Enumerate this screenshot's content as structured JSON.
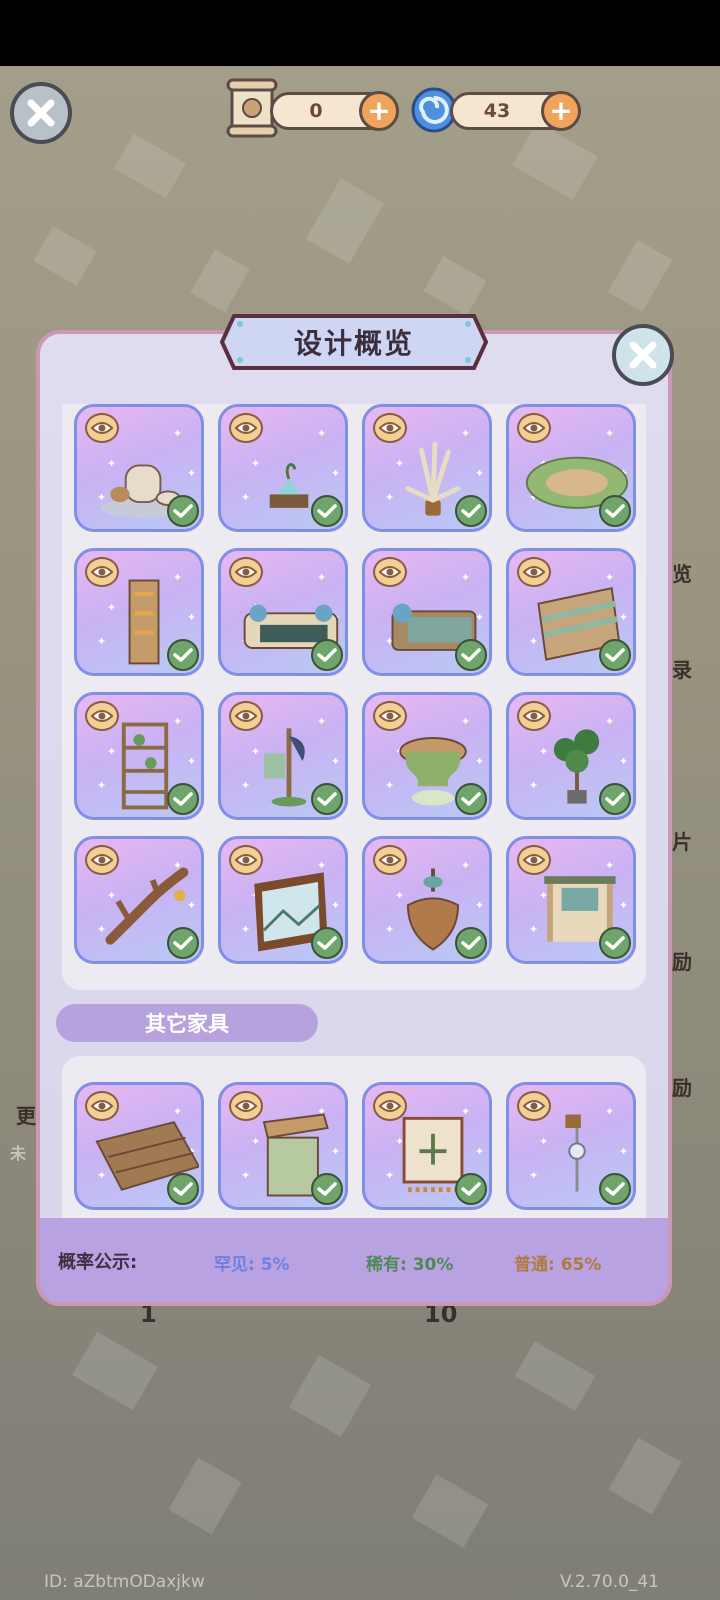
{
  "currency": {
    "scrolls": "0",
    "swirls": "43"
  },
  "modal": {
    "title": "设计概览",
    "section_other": "其它家具"
  },
  "cards_main": [
    {
      "name": "tea-set",
      "icon": "teapot-icon"
    },
    {
      "name": "potted-succulent",
      "icon": "succulent-icon"
    },
    {
      "name": "pampas-vase",
      "icon": "pampas-grass-icon"
    },
    {
      "name": "moss-rug",
      "icon": "moss-rug-icon"
    },
    {
      "name": "flower-trellis",
      "icon": "trellis-icon"
    },
    {
      "name": "sofa",
      "icon": "sofa-icon"
    },
    {
      "name": "bed",
      "icon": "bed-icon"
    },
    {
      "name": "dresser",
      "icon": "dresser-icon"
    },
    {
      "name": "bookshelf",
      "icon": "shelf-icon"
    },
    {
      "name": "coat-rack",
      "icon": "coat-rack-icon"
    },
    {
      "name": "moss-stool",
      "icon": "stool-icon"
    },
    {
      "name": "potted-tree",
      "icon": "tree-icon"
    },
    {
      "name": "antler-bells",
      "icon": "antler-icon"
    },
    {
      "name": "landscape-painting",
      "icon": "painting-icon"
    },
    {
      "name": "pinecone-lamp",
      "icon": "pinecone-icon"
    },
    {
      "name": "window-curtain",
      "icon": "curtain-icon"
    }
  ],
  "cards_other": [
    {
      "name": "wood-floor",
      "icon": "floor-icon"
    },
    {
      "name": "side-table",
      "icon": "table-icon"
    },
    {
      "name": "tapestry",
      "icon": "tapestry-icon"
    },
    {
      "name": "wind-chime",
      "icon": "chime-icon"
    }
  ],
  "probability": {
    "label": "概率公示:",
    "rare": "罕见: 5%",
    "uncommon": "稀有: 30%",
    "common": "普通: 65%",
    "colors": {
      "rare": "#6f7fe0",
      "uncommon": "#4f8a55",
      "common": "#b07a3e"
    }
  },
  "side": {
    "l1": "览",
    "l2": "录",
    "l3": "片",
    "l4": "励",
    "l5": "励",
    "left1": "更",
    "left2": "未"
  },
  "bottom_counts": {
    "one": "1",
    "ten": "10"
  },
  "footer": {
    "id": "ID: aZbtmODaxjkw",
    "version": "V.2.70.0_41"
  },
  "colors": {
    "card_border": "#7f8fe6",
    "check": "#6da56b",
    "section": "#b6a3de"
  }
}
